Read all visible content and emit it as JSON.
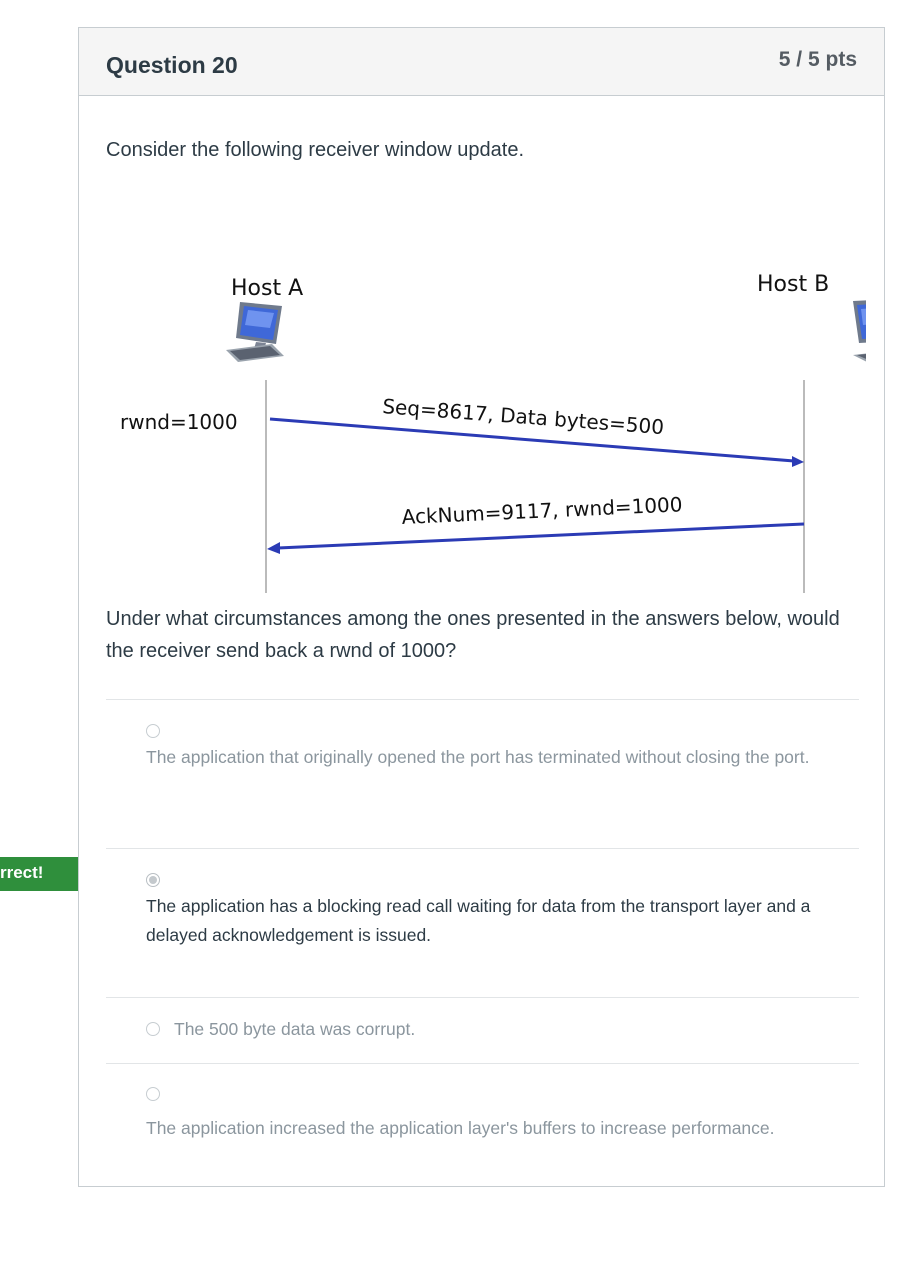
{
  "question": {
    "title": "Question 20",
    "points": "5 / 5 pts",
    "prompt": "Consider the following receiver window update.",
    "body": "Under what circumstances among the ones presented in the answers below, would the receiver send back a rwnd of 1000?"
  },
  "diagram": {
    "host_a_label": "Host A",
    "host_b_label": "Host B",
    "rwnd_label": "rwnd=1000",
    "message_1": "Seq=8617, Data bytes=500",
    "message_2": "AckNum=9117, rwnd=1000",
    "arrow_color": "#2b3bb5"
  },
  "feedback": {
    "label": "rrect!",
    "color": "#2f8f3c"
  },
  "answers": [
    {
      "text": "The application that originally opened the port has terminated without closing the port.",
      "selected": false
    },
    {
      "text": "The application has a blocking read call waiting for data from the transport layer and a delayed acknowledgement is issued.",
      "selected": true
    },
    {
      "text": "The 500 byte data was corrupt.",
      "selected": false
    },
    {
      "text": "The application increased the application layer's buffers to increase performance.",
      "selected": false
    }
  ]
}
